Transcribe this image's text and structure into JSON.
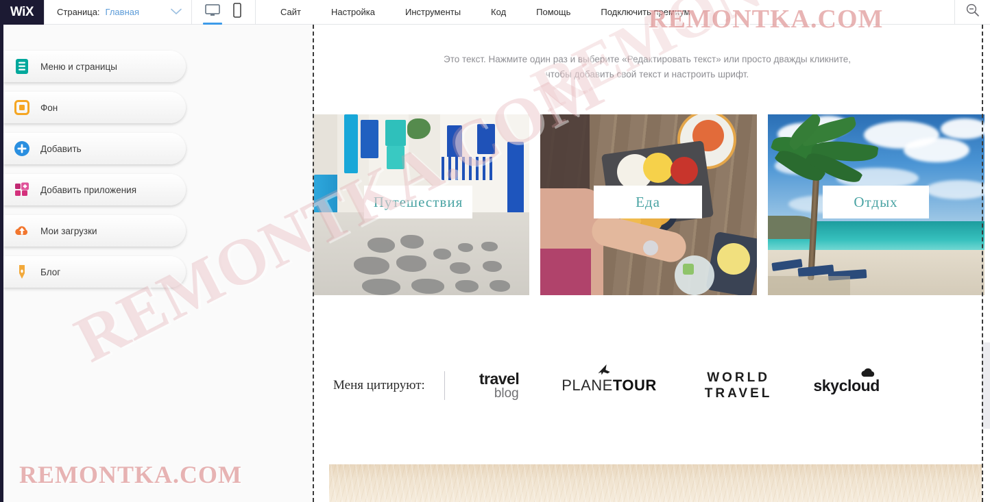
{
  "topbar": {
    "logo": "WiX",
    "page_selector": {
      "label": "Страница:",
      "value": "Главная",
      "chevron_icon": "chevron-down-icon"
    },
    "devices": [
      {
        "name": "desktop",
        "icon": "desktop-icon",
        "active": true
      },
      {
        "name": "mobile",
        "icon": "mobile-icon",
        "active": false
      }
    ],
    "menu": [
      "Сайт",
      "Настройка",
      "Инструменты",
      "Код",
      "Помощь",
      "Подключить премиум"
    ],
    "zoom_out_icon": "magnifier-minus-icon"
  },
  "sidebar": {
    "items": [
      {
        "label": "Меню и страницы",
        "icon": "menu-pages-icon",
        "color": "#00a89c"
      },
      {
        "label": "Фон",
        "icon": "background-icon",
        "color": "#f5a623"
      },
      {
        "label": "Добавить",
        "icon": "plus-circle-icon",
        "color": "#2a8fe0"
      },
      {
        "label": "Добавить приложения",
        "icon": "apps-grid-icon",
        "color": "#d4317c"
      },
      {
        "label": "Мои загрузки",
        "icon": "upload-cloud-icon",
        "color": "#f2762e"
      },
      {
        "label": "Блог",
        "icon": "pen-nib-icon",
        "color": "#f2a93b"
      }
    ]
  },
  "canvas": {
    "intro_text_line1": "Это текст. Нажмите один раз и выберите «Редактировать текст» или просто дважды кликните,",
    "intro_text_line2": "чтобы добавить свой текст и настроить шрифт.",
    "cards": [
      {
        "label": "Путешествия",
        "image": "greek-alley-photo",
        "label_color": "#49a3a3"
      },
      {
        "label": "Еда",
        "image": "food-table-photo",
        "label_color": "#49a3a3"
      },
      {
        "label": "Отдых",
        "image": "beach-palm-photo",
        "label_color": "#49a3a3"
      }
    ],
    "logo_band": {
      "quoted_label": "Меня цитируют:",
      "brands": [
        {
          "name": "travel-blog-logo",
          "line1": "travel",
          "line2": "blog"
        },
        {
          "name": "planetour-logo",
          "part1": "PLANE",
          "part2": "TOUR",
          "icon": "airplane-icon"
        },
        {
          "name": "world-travel-logo",
          "line1": "WORLD",
          "line2": "TRAVEL"
        },
        {
          "name": "skycloud-logo",
          "line1": "skycloud",
          "icon": "cloud-icon"
        }
      ]
    },
    "bottom_strip_image": "sand-texture-photo"
  },
  "watermark": {
    "text": "REMONTKA.COM",
    "color": "#d67676"
  }
}
